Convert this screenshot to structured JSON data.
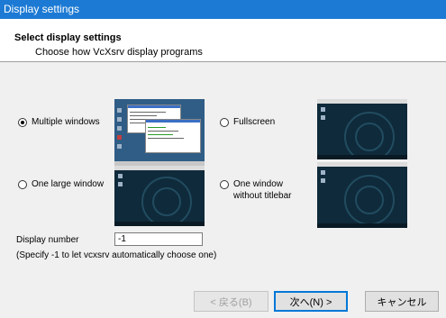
{
  "window": {
    "title": "Display settings"
  },
  "header": {
    "title": "Select display settings",
    "subtitle": "Choose how VcXsrv display programs"
  },
  "options": [
    {
      "id": "multiple",
      "label": "Multiple windows",
      "checked": true
    },
    {
      "id": "fullscreen",
      "label": "Fullscreen",
      "checked": false
    },
    {
      "id": "onelarge",
      "label": "One large window",
      "checked": false
    },
    {
      "id": "notitle",
      "label": "One window\nwithout titlebar",
      "checked": false
    }
  ],
  "display_number": {
    "label": "Display number",
    "value": "-1",
    "hint": "(Specify -1 to let vcxsrv automatically choose one)"
  },
  "buttons": {
    "back": "< 戻る(B)",
    "next": "次へ(N) >",
    "cancel": "キャンセル"
  },
  "colors": {
    "titlebar": "#1c7ad4",
    "preview_desktop": "#0f2a3a",
    "default_button_border": "#0078d7"
  }
}
